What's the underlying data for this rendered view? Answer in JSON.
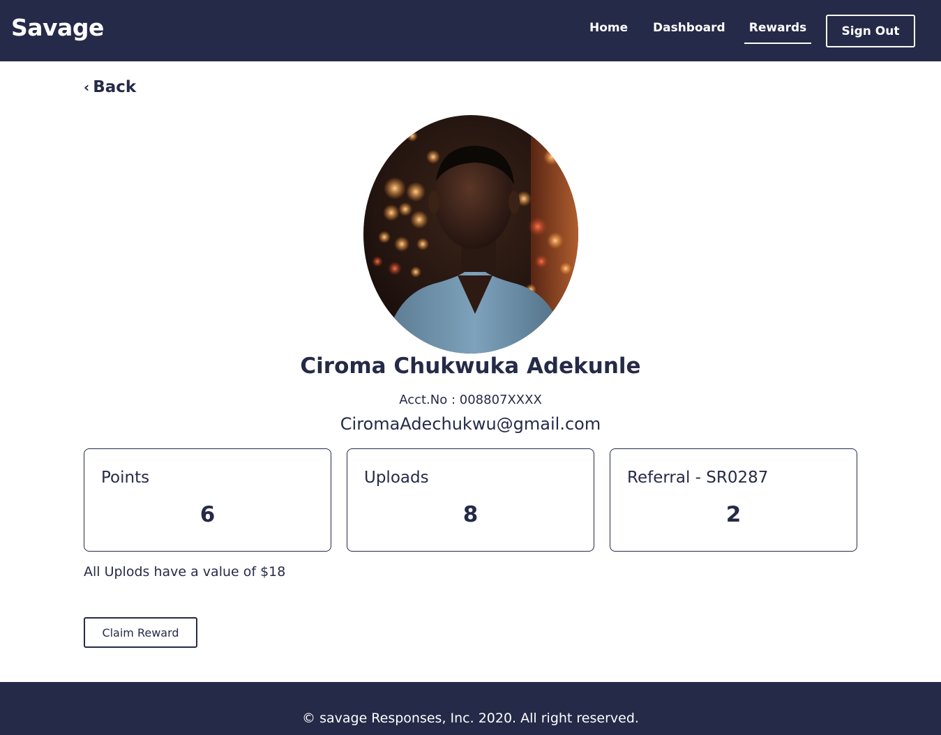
{
  "header": {
    "brand": "Savage",
    "nav": {
      "home": "Home",
      "dashboard": "Dashboard",
      "rewards": "Rewards"
    },
    "sign_out": "Sign Out",
    "active_tab": "Rewards"
  },
  "back": {
    "label": "Back",
    "icon": "chevron-left-icon"
  },
  "profile": {
    "name": "Ciroma Chukwuka Adekunle",
    "acct": "Acct.No : 008807XXXX",
    "email": "CiromaAdechukwu@gmail.com"
  },
  "stats": [
    {
      "label": "Points",
      "value": "6"
    },
    {
      "label": "Uploads",
      "value": "8"
    },
    {
      "label": "Referral - SR0287",
      "value": "2"
    }
  ],
  "note": "All Uplods have a value of $18",
  "claim_button": "Claim Reward",
  "footer": {
    "text": "© savage Responses, Inc. 2020. All right reserved."
  },
  "colors": {
    "primary": "#252a48",
    "background": "#ffffff",
    "text_on_primary": "#ffffff"
  }
}
